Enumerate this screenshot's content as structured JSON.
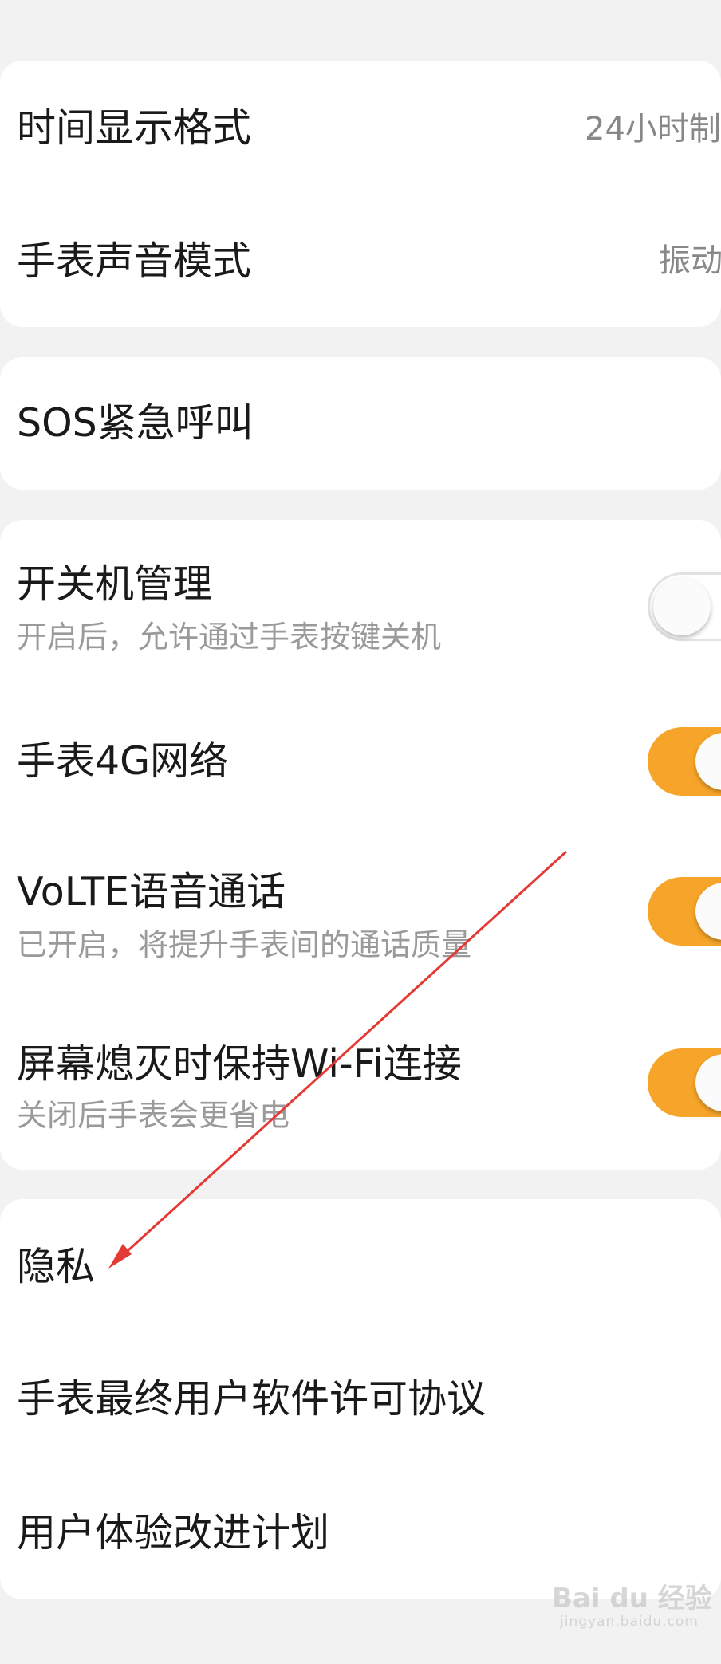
{
  "group1": {
    "time_format": {
      "label": "时间显示格式",
      "value": "24小时制"
    },
    "sound_mode": {
      "label": "手表声音模式",
      "value": "振动"
    }
  },
  "group2": {
    "sos": {
      "label": "SOS紧急呼叫"
    }
  },
  "group3": {
    "power": {
      "label": "开关机管理",
      "desc": "开启后，允许通过手表按键关机",
      "enabled": false
    },
    "network4g": {
      "label": "手表4G网络",
      "enabled": true
    },
    "volte": {
      "label": "VoLTE语音通话",
      "desc": "已开启，将提升手表间的通话质量",
      "enabled": true
    },
    "wifi": {
      "label": "屏幕熄灭时保持Wi-Fi连接",
      "desc": "关闭后手表会更省电",
      "enabled": true
    }
  },
  "group4": {
    "privacy": {
      "label": "隐私"
    },
    "eula": {
      "label": "手表最终用户软件许可协议"
    },
    "ux_plan": {
      "label": "用户体验改进计划"
    }
  },
  "colors": {
    "toggle_on": "#f7a52a",
    "annotation_arrow": "#e53935"
  },
  "watermark": {
    "text": "Bai du 经验",
    "sub": "jingyan.baidu.com"
  }
}
